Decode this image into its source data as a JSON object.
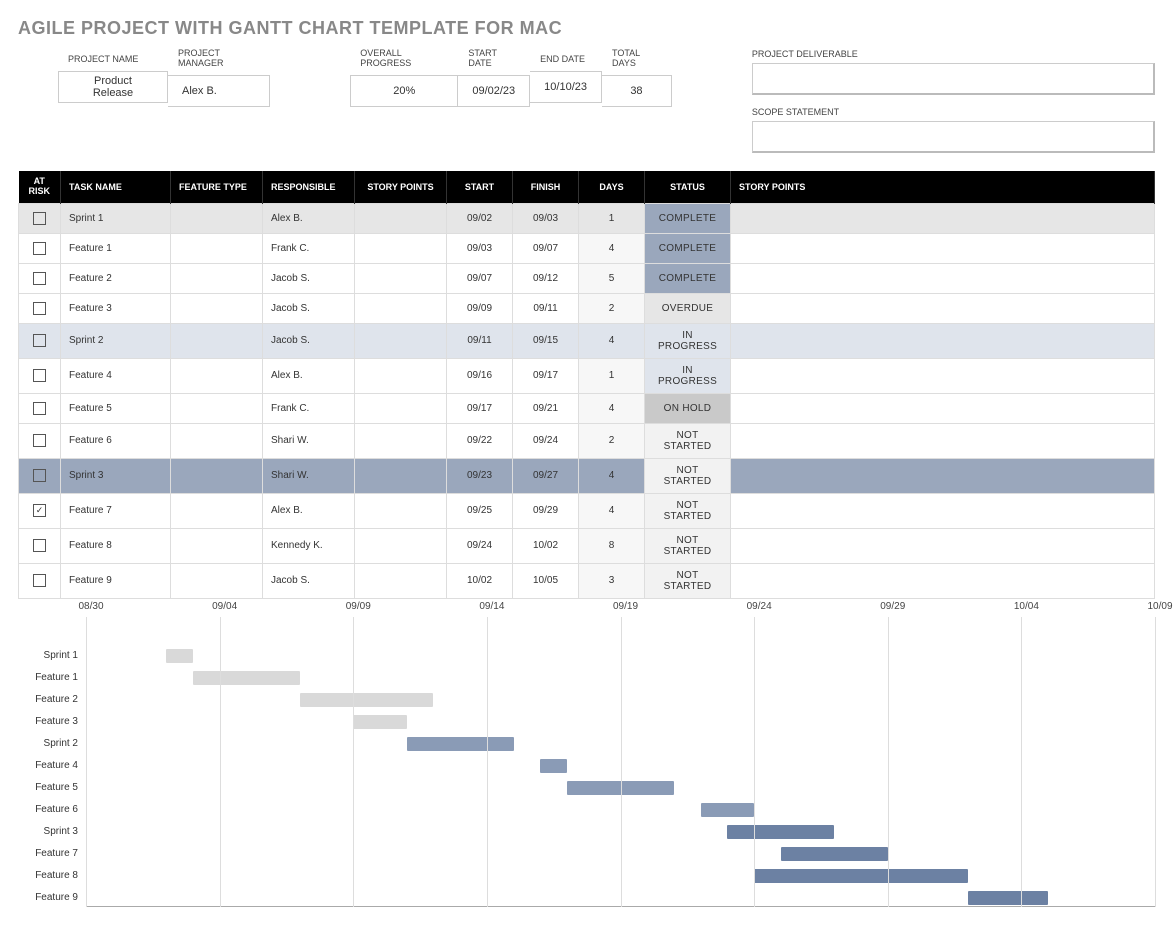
{
  "title": "AGILE PROJECT WITH GANTT CHART TEMPLATE FOR MAC",
  "header": {
    "project_name_label": "PROJECT NAME",
    "project_name": "Product Release",
    "project_manager_label": "PROJECT MANAGER",
    "project_manager": "Alex B.",
    "overall_progress_label": "OVERALL PROGRESS",
    "overall_progress": "20%",
    "start_date_label": "START DATE",
    "start_date": "09/02/23",
    "end_date_label": "END DATE",
    "end_date": "10/10/23",
    "total_days_label": "TOTAL DAYS",
    "total_days": "38",
    "project_deliverable_label": "PROJECT DELIVERABLE",
    "project_deliverable": "",
    "scope_statement_label": "SCOPE STATEMENT",
    "scope_statement": ""
  },
  "columns": {
    "at_risk": "AT RISK",
    "task_name": "TASK NAME",
    "feature_type": "FEATURE TYPE",
    "responsible": "RESPONSIBLE",
    "story_points": "STORY POINTS",
    "start": "START",
    "finish": "FINISH",
    "days": "DAYS",
    "status": "STATUS",
    "story_points2": "STORY POINTS"
  },
  "rows": [
    {
      "at_risk": false,
      "task": "Sprint 1",
      "type": "",
      "responsible": "Alex B.",
      "pts": "",
      "start": "09/02",
      "finish": "09/03",
      "days": "1",
      "status": "COMPLETE",
      "s_class": "complete",
      "row_class": "sprint-1"
    },
    {
      "at_risk": false,
      "task": "Feature 1",
      "type": "",
      "responsible": "Frank C.",
      "pts": "",
      "start": "09/03",
      "finish": "09/07",
      "days": "4",
      "status": "COMPLETE",
      "s_class": "complete",
      "row_class": ""
    },
    {
      "at_risk": false,
      "task": "Feature 2",
      "type": "",
      "responsible": "Jacob S.",
      "pts": "",
      "start": "09/07",
      "finish": "09/12",
      "days": "5",
      "status": "COMPLETE",
      "s_class": "complete",
      "row_class": ""
    },
    {
      "at_risk": false,
      "task": "Feature 3",
      "type": "",
      "responsible": "Jacob S.",
      "pts": "",
      "start": "09/09",
      "finish": "09/11",
      "days": "2",
      "status": "OVERDUE",
      "s_class": "overdue",
      "row_class": ""
    },
    {
      "at_risk": false,
      "task": "Sprint 2",
      "type": "",
      "responsible": "Jacob S.",
      "pts": "",
      "start": "09/11",
      "finish": "09/15",
      "days": "4",
      "status": "IN PROGRESS",
      "s_class": "inprogress",
      "row_class": "sprint-2"
    },
    {
      "at_risk": false,
      "task": "Feature 4",
      "type": "",
      "responsible": "Alex B.",
      "pts": "",
      "start": "09/16",
      "finish": "09/17",
      "days": "1",
      "status": "IN PROGRESS",
      "s_class": "inprogress",
      "row_class": ""
    },
    {
      "at_risk": false,
      "task": "Feature 5",
      "type": "",
      "responsible": "Frank C.",
      "pts": "",
      "start": "09/17",
      "finish": "09/21",
      "days": "4",
      "status": "ON HOLD",
      "s_class": "onhold",
      "row_class": ""
    },
    {
      "at_risk": false,
      "task": "Feature 6",
      "type": "",
      "responsible": "Shari W.",
      "pts": "",
      "start": "09/22",
      "finish": "09/24",
      "days": "2",
      "status": "NOT STARTED",
      "s_class": "notstarted",
      "row_class": ""
    },
    {
      "at_risk": false,
      "task": "Sprint 3",
      "type": "",
      "responsible": "Shari W.",
      "pts": "",
      "start": "09/23",
      "finish": "09/27",
      "days": "4",
      "status": "NOT STARTED",
      "s_class": "notstarted",
      "row_class": "sprint-3"
    },
    {
      "at_risk": true,
      "task": "Feature 7",
      "type": "",
      "responsible": "Alex B.",
      "pts": "",
      "start": "09/25",
      "finish": "09/29",
      "days": "4",
      "status": "NOT STARTED",
      "s_class": "notstarted",
      "row_class": ""
    },
    {
      "at_risk": false,
      "task": "Feature 8",
      "type": "",
      "responsible": "Kennedy K.",
      "pts": "",
      "start": "09/24",
      "finish": "10/02",
      "days": "8",
      "status": "NOT STARTED",
      "s_class": "notstarted",
      "row_class": ""
    },
    {
      "at_risk": false,
      "task": "Feature 9",
      "type": "",
      "responsible": "Jacob S.",
      "pts": "",
      "start": "10/02",
      "finish": "10/05",
      "days": "3",
      "status": "NOT STARTED",
      "s_class": "notstarted",
      "row_class": ""
    }
  ],
  "chart_data": {
    "type": "bar",
    "orientation": "horizontal-gantt",
    "title": "",
    "xlabel": "",
    "ylabel": "",
    "x_axis_origin": "08/30",
    "x_ticks": [
      "08/30",
      "09/04",
      "09/09",
      "09/14",
      "09/19",
      "09/24",
      "09/29",
      "10/04",
      "10/09"
    ],
    "x_tick_day_index": [
      0,
      5,
      10,
      15,
      20,
      25,
      30,
      35,
      40
    ],
    "categories": [
      "Sprint 1",
      "Feature 1",
      "Feature 2",
      "Feature 3",
      "Sprint 2",
      "Feature 4",
      "Feature 5",
      "Feature 6",
      "Sprint 3",
      "Feature 7",
      "Feature 8",
      "Feature 9"
    ],
    "bars": [
      {
        "task": "Sprint 1",
        "start_day": 3,
        "duration": 1,
        "color": "grey"
      },
      {
        "task": "Feature 1",
        "start_day": 4,
        "duration": 4,
        "color": "grey"
      },
      {
        "task": "Feature 2",
        "start_day": 8,
        "duration": 5,
        "color": "grey"
      },
      {
        "task": "Feature 3",
        "start_day": 10,
        "duration": 2,
        "color": "grey"
      },
      {
        "task": "Sprint 2",
        "start_day": 12,
        "duration": 4,
        "color": "blue1"
      },
      {
        "task": "Feature 4",
        "start_day": 17,
        "duration": 1,
        "color": "blue1"
      },
      {
        "task": "Feature 5",
        "start_day": 18,
        "duration": 4,
        "color": "blue1"
      },
      {
        "task": "Feature 6",
        "start_day": 23,
        "duration": 2,
        "color": "blue1"
      },
      {
        "task": "Sprint 3",
        "start_day": 24,
        "duration": 4,
        "color": "blue2"
      },
      {
        "task": "Feature 7",
        "start_day": 26,
        "duration": 4,
        "color": "blue2"
      },
      {
        "task": "Feature 8",
        "start_day": 25,
        "duration": 8,
        "color": "blue2"
      },
      {
        "task": "Feature 9",
        "start_day": 33,
        "duration": 3,
        "color": "blue2"
      }
    ],
    "x_range_days": 40,
    "bar_colors": {
      "grey": "#d9d9d9",
      "blue1": "#8a9bb6",
      "blue2": "#6c81a3"
    }
  }
}
